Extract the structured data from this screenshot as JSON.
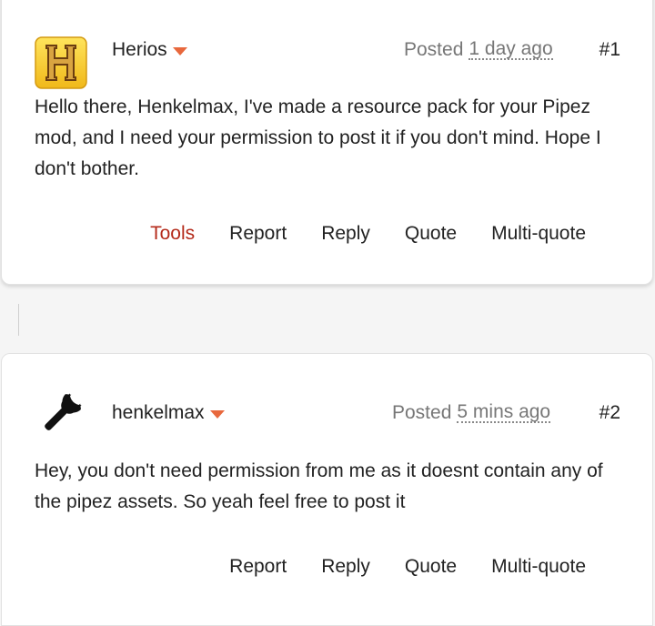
{
  "posts": [
    {
      "author": "Herios",
      "posted_prefix": "Posted",
      "posted_time": "1 day ago",
      "number": "#1",
      "body": "Hello there, Henkelmax, I've made a resource pack for your Pipez mod, and I need your permission to post it if you don't mind. Hope I don't bother.",
      "avatar_icon": "h-letter-badge-icon",
      "actions": [
        "Tools",
        "Report",
        "Reply",
        "Quote",
        "Multi-quote"
      ]
    },
    {
      "author": "henkelmax",
      "posted_prefix": "Posted",
      "posted_time": "5 mins ago",
      "number": "#2",
      "body": "Hey, you don't need permission from me as it doesnt contain any of the pipez assets. So yeah feel free to post it",
      "avatar_icon": "wrench-icon",
      "actions": [
        "Report",
        "Reply",
        "Quote",
        "Multi-quote"
      ]
    }
  ],
  "colors": {
    "accent_caret": "#e8683d",
    "tools_link": "#b42a1a",
    "avatar_gold": "#f0c419",
    "avatar_brown": "#8a5a1f"
  }
}
